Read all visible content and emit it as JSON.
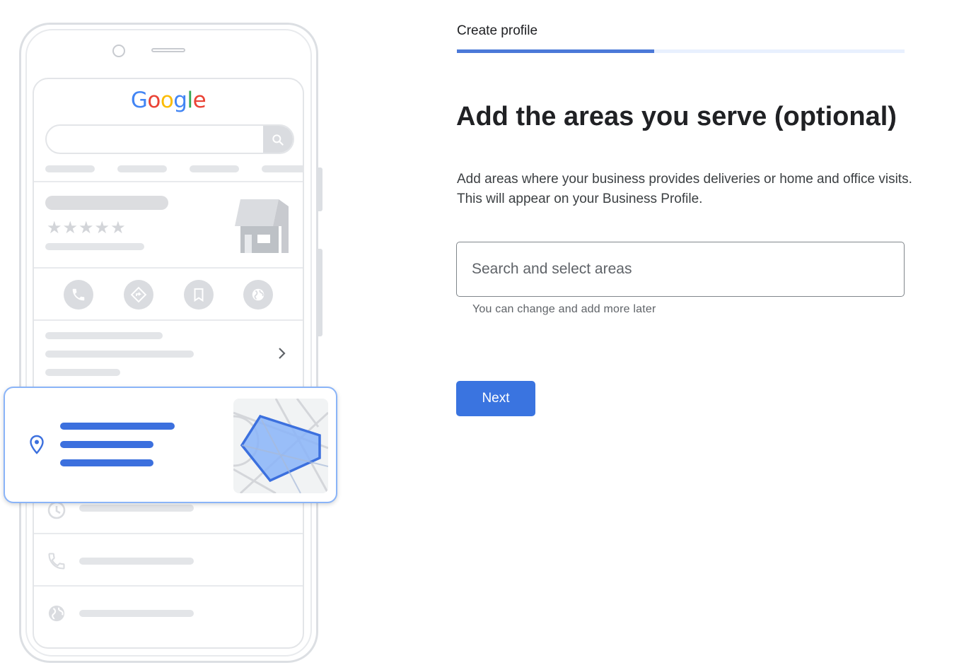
{
  "illustration": {
    "logo_text": "Google",
    "icons": {
      "search": "search-icon",
      "phone": "phone-icon",
      "directions": "directions-icon",
      "bookmark": "bookmark-icon",
      "website": "globe-icon",
      "chevron": "chevron-right-icon",
      "clock": "clock-icon",
      "location": "location-pin-icon",
      "storefront": "storefront-icon"
    },
    "star_count": 5,
    "accent_color": "#3c70de"
  },
  "header": {
    "step_label": "Create profile",
    "progress_fraction": 0.44,
    "progress_color": "#4b79d8"
  },
  "main": {
    "title": "Add the areas you serve (optional)",
    "description": "Add areas where your business provides deliveries or home and office visits. This will appear on your Business Profile.",
    "search": {
      "placeholder": "Search and select areas",
      "value": "",
      "helper": "You can change and add more later"
    },
    "next_label": "Next",
    "button_color": "#3a74e0"
  }
}
